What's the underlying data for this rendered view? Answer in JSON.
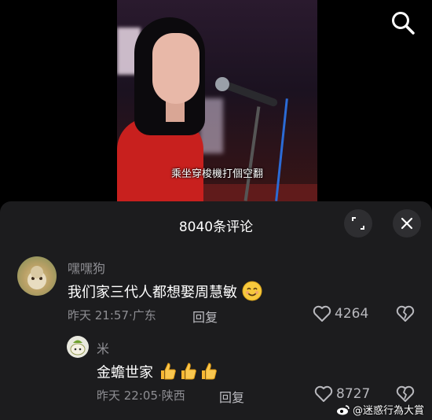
{
  "video": {
    "subtitle": "乘坐穿梭機打個空翻"
  },
  "comments_panel": {
    "count_label": "8040条评论",
    "comments": [
      {
        "username": "嘿嘿狗",
        "text": "我们家三代人都想娶周慧敏",
        "time": "昨天 21:57",
        "location": "广东",
        "reply_label": "回复",
        "likes": "4264"
      }
    ],
    "replies": [
      {
        "username": "米",
        "text": "金蟾世家",
        "time": "昨天 22:05",
        "location": "陕西",
        "reply_label": "回复",
        "likes": "8727"
      }
    ]
  },
  "watermark": "@迷惑行為大賞",
  "colors": {
    "panel_bg": "#1c1c1e",
    "muted": "#8e8e93",
    "accent_red": "#c8201e"
  },
  "icons": [
    "search-icon",
    "expand-icon",
    "close-icon",
    "heart-icon",
    "broken-heart-icon",
    "smile-emoji",
    "thumbs-up-emoji",
    "weibo-icon"
  ]
}
